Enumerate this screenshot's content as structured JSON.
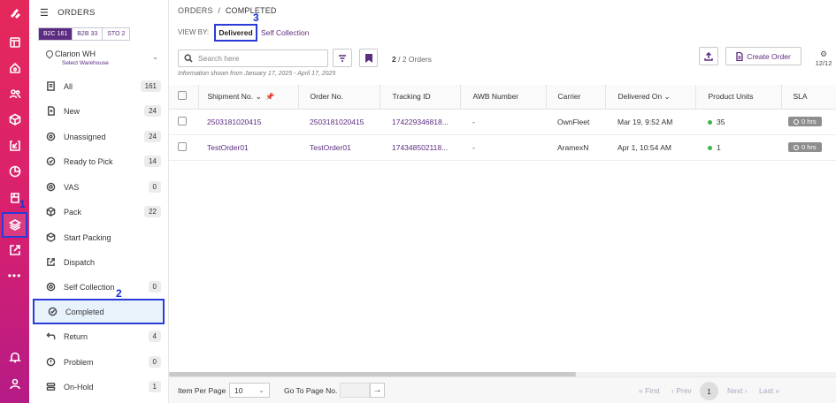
{
  "rail": {
    "icons": [
      "logo-icon",
      "dashboard-icon",
      "home-icon",
      "users-icon",
      "box-icon",
      "returns-icon",
      "analytics-icon",
      "inventory-icon",
      "orders-icon",
      "external-icon",
      "more-icon",
      "bell-icon",
      "profile-icon"
    ],
    "annotation": "1"
  },
  "sidebar": {
    "title": "ORDERS",
    "channels": [
      {
        "label": "B2C",
        "count": "161"
      },
      {
        "label": "B2B",
        "count": "33"
      },
      {
        "label": "STO",
        "count": "2"
      }
    ],
    "warehouse": {
      "name": "Clarion WH",
      "sub": "Select Warehouse"
    },
    "items": [
      {
        "label": "All",
        "count": "161"
      },
      {
        "label": "New",
        "count": "24"
      },
      {
        "label": "Unassigned",
        "count": "24"
      },
      {
        "label": "Ready to Pick",
        "count": "14"
      },
      {
        "label": "VAS",
        "count": "0"
      },
      {
        "label": "Pack",
        "count": "22"
      },
      {
        "label": "Start Packing",
        "count": ""
      },
      {
        "label": "Dispatch",
        "count": ""
      },
      {
        "label": "Self Collection",
        "count": "0"
      },
      {
        "label": "Completed",
        "count": ""
      },
      {
        "label": "Return",
        "count": "4"
      },
      {
        "label": "Problem",
        "count": "0"
      },
      {
        "label": "On-Hold",
        "count": "1"
      }
    ],
    "annotation": "2"
  },
  "main": {
    "breadcrumb_root": "ORDERS",
    "breadcrumb_sep": "/",
    "breadcrumb_current": "COMPLETED",
    "view_by_label": "VIEW BY:",
    "tabs": [
      "Delivered",
      "Self Collection"
    ],
    "tab_annotation": "3",
    "search_placeholder": "Search here",
    "count_shown": "2",
    "count_total": "/ 2 Orders",
    "info": "Information shown from January 17, 2025 - April 17, 2025",
    "create_label": "Create Order",
    "col_count": "12/12"
  },
  "table": {
    "headers": [
      "Shipment No.",
      "Order No.",
      "Tracking ID",
      "AWB Number",
      "Carrier",
      "Delivered On",
      "Product Units",
      "SLA"
    ],
    "rows": [
      {
        "shipment": "2503181020415",
        "order": "2503181020415",
        "tracking": "174229346818...",
        "awb": "-",
        "carrier": "OwnFleet",
        "delivered": "Mar 19, 9:52 AM",
        "units": "35",
        "sla": "0 hrs"
      },
      {
        "shipment": "TestOrder01",
        "order": "TestOrder01",
        "tracking": "174348502118...",
        "awb": "-",
        "carrier": "AramexN",
        "delivered": "Apr 1, 10:54 AM",
        "units": "1",
        "sla": "0 hrs"
      }
    ]
  },
  "footer": {
    "items_per_page_label": "Item Per Page",
    "items_per_page": "10",
    "goto_label": "Go To Page No.",
    "first": "« First",
    "prev": "‹ Prev",
    "page": "1",
    "next": "Next ›",
    "last": "Last »"
  },
  "colors": {
    "accent": "#5b2c80",
    "rail_top": "#e5285a",
    "rail_bottom": "#b51b86",
    "highlight": "#2a3bd8",
    "status_green": "#3bb54a"
  }
}
